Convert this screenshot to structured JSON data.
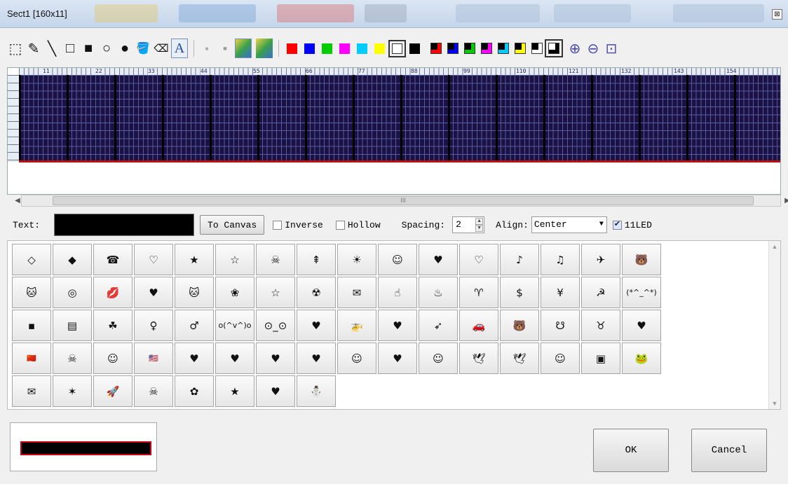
{
  "window": {
    "title": "Sect1 [160x11]",
    "close_glyph": "⊠"
  },
  "toolbar": {
    "tools": [
      {
        "name": "rectangle-select-icon",
        "glyph": "⬚"
      },
      {
        "name": "pencil-icon",
        "glyph": "✎"
      },
      {
        "name": "line-icon",
        "glyph": "╲"
      },
      {
        "name": "rectangle-outline-icon",
        "glyph": "□"
      },
      {
        "name": "rectangle-filled-icon",
        "glyph": "■"
      },
      {
        "name": "ellipse-outline-icon",
        "glyph": "○"
      },
      {
        "name": "ellipse-filled-icon",
        "glyph": "●"
      },
      {
        "name": "fill-bucket-icon",
        "glyph": "🪣"
      },
      {
        "name": "eraser-icon",
        "glyph": "⌫"
      },
      {
        "name": "text-tool-icon",
        "glyph": "A"
      }
    ],
    "colors": [
      "#ff0000",
      "#0000ff",
      "#00cc00",
      "#ff00ff",
      "#00ccff",
      "#ffff00",
      "#ffffff",
      "#000000"
    ],
    "dual_colors": [
      {
        "bg": "#ff0000",
        "fg": "#000000"
      },
      {
        "bg": "#0000ff",
        "fg": "#000000"
      },
      {
        "bg": "#00cc00",
        "fg": "#000000"
      },
      {
        "bg": "#ff00ff",
        "fg": "#000000"
      },
      {
        "bg": "#00ccff",
        "fg": "#000000"
      },
      {
        "bg": "#ffff00",
        "fg": "#000000"
      },
      {
        "bg": "#ffffff",
        "fg": "#000000"
      },
      {
        "bg": "#000000",
        "fg": "#ffffff"
      }
    ],
    "zoom_in_icon": "⊕",
    "zoom_out_icon": "⊖",
    "zoom_fit_icon": "⊡"
  },
  "ruler": {
    "labels": [
      "11",
      "22",
      "33",
      "44",
      "55",
      "66",
      "77",
      "88",
      "99",
      "110",
      "121",
      "132",
      "143",
      "154"
    ]
  },
  "scroll_thumb_glyph": "III",
  "text_options": {
    "text_label": "Text:",
    "to_canvas": "To Canvas",
    "inverse": "Inverse",
    "hollow": "Hollow",
    "spacing_label": "Spacing:",
    "spacing_value": "2",
    "align_label": "Align:",
    "align_value": "Center",
    "led_label": "11LED"
  },
  "symbols": [
    "◇",
    "◆",
    "☎",
    "♡",
    "★",
    "☆",
    "☠",
    "⇞",
    "☀",
    "☺",
    "♥",
    "♡",
    "♪",
    "♫",
    "✈",
    "🐻",
    "🐱",
    "◎",
    "💋",
    "♥",
    "🐱",
    "❀",
    "☆",
    "☢",
    "✉",
    "☝",
    "♨",
    "♈",
    "$",
    "¥",
    "☭",
    "(*^_^*)",
    "▪",
    "▤",
    "☘",
    "♀",
    "♂",
    "o(^v^)o",
    "⊙_⊙",
    "♥",
    "🚁",
    "♥",
    "➶",
    "🚗",
    "🐻",
    "☋",
    "♉",
    "♥",
    "🇨🇳",
    "☠",
    "☺",
    "🇺🇸",
    "♥",
    "♥",
    "♥",
    "♥",
    "☺",
    "♥",
    "☺",
    "🕊",
    "🕊",
    "☺",
    "▣",
    "🐸",
    "✉",
    "✶",
    "🚀",
    "☠",
    "✿",
    "★",
    "♥",
    "⛄"
  ],
  "buttons": {
    "ok": "OK",
    "cancel": "Cancel"
  }
}
